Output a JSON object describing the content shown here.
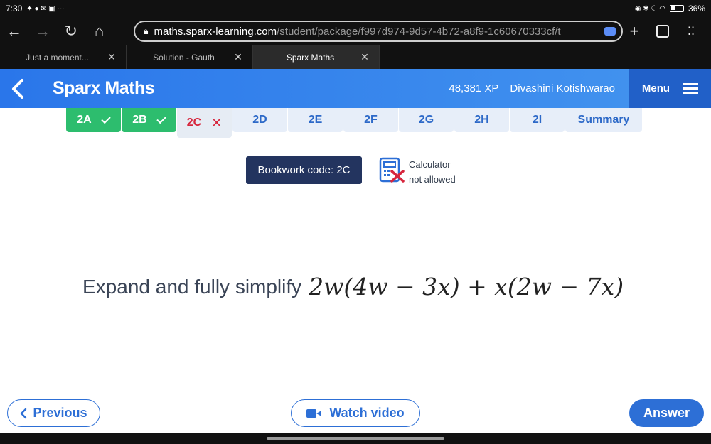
{
  "status_bar": {
    "time": "7:30",
    "left_glyphs": "⁣✦ ● ✉ ▣ ···",
    "battery": "36%"
  },
  "browser": {
    "url_host": "maths.sparx-learning.com",
    "url_path": "/student/package/f997d974-9d57-4b72-a8f9-1c60670333cf/t",
    "tabs": [
      {
        "title": "Just a moment..."
      },
      {
        "title": "Solution - Gauth"
      },
      {
        "title": "Sparx Maths"
      }
    ]
  },
  "header": {
    "title": "Sparx Maths",
    "xp": "48,381 XP",
    "username": "Divashini Kotishwarao",
    "menu_label": "Menu"
  },
  "task_tabs": [
    {
      "label": "2A",
      "status": "done"
    },
    {
      "label": "2B",
      "status": "done"
    },
    {
      "label": "2C",
      "status": "wrong"
    },
    {
      "label": "2D",
      "status": "todo"
    },
    {
      "label": "2E",
      "status": "todo"
    },
    {
      "label": "2F",
      "status": "todo"
    },
    {
      "label": "2G",
      "status": "todo"
    },
    {
      "label": "2H",
      "status": "todo"
    },
    {
      "label": "2I",
      "status": "todo"
    },
    {
      "label": "Summary",
      "status": "summary"
    }
  ],
  "bookwork": {
    "label": "Bookwork code: 2C"
  },
  "calculator": {
    "line1": "Calculator",
    "line2": "not allowed"
  },
  "question": {
    "text": "Expand and fully simplify",
    "expression": "2w(4w − 3x) + x(2w − 7x)"
  },
  "buttons": {
    "previous": "Previous",
    "watch_video": "Watch video",
    "answer": "Answer"
  },
  "colors": {
    "header_blue": "#2a76ea",
    "done_green": "#2dbd6e",
    "wrong_red": "#d7263d",
    "bookwork_navy": "#23345f",
    "button_blue": "#2d6fd6"
  }
}
